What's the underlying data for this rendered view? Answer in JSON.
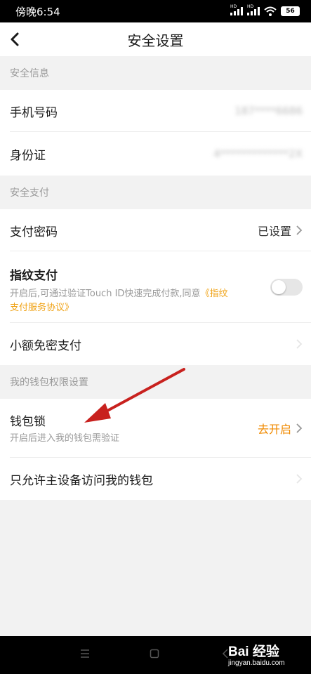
{
  "status": {
    "time": "傍晚6:54",
    "battery": "56",
    "signal_hd": "HD"
  },
  "header": {
    "title": "安全设置"
  },
  "sections": {
    "security_info": "安全信息",
    "secure_pay": "安全支付",
    "wallet_perm": "我的钱包权限设置"
  },
  "rows": {
    "phone": {
      "label": "手机号码",
      "value": "187****6686"
    },
    "id_card": {
      "label": "身份证",
      "value": "4*************2X"
    },
    "pay_password": {
      "label": "支付密码",
      "value": "已设置"
    },
    "fingerprint": {
      "label": "指纹支付",
      "desc_prefix": "开启后,可通过验证Touch ID快速完成付款,同意",
      "desc_link": "《指纹支付服务协议》",
      "enabled": false
    },
    "small_free": {
      "label": "小额免密支付"
    },
    "wallet_lock": {
      "label": "钱包锁",
      "desc": "开启后进入我的钱包需验证",
      "action": "去开启"
    },
    "main_device": {
      "label": "只允许主设备访问我的钱包"
    }
  },
  "watermark": {
    "main": "Bai 经验",
    "sub": "jingyan.baidu.com"
  },
  "colors": {
    "accent": "#f08a00",
    "link": "#f0a317",
    "annotation_arrow": "#c8211e"
  }
}
